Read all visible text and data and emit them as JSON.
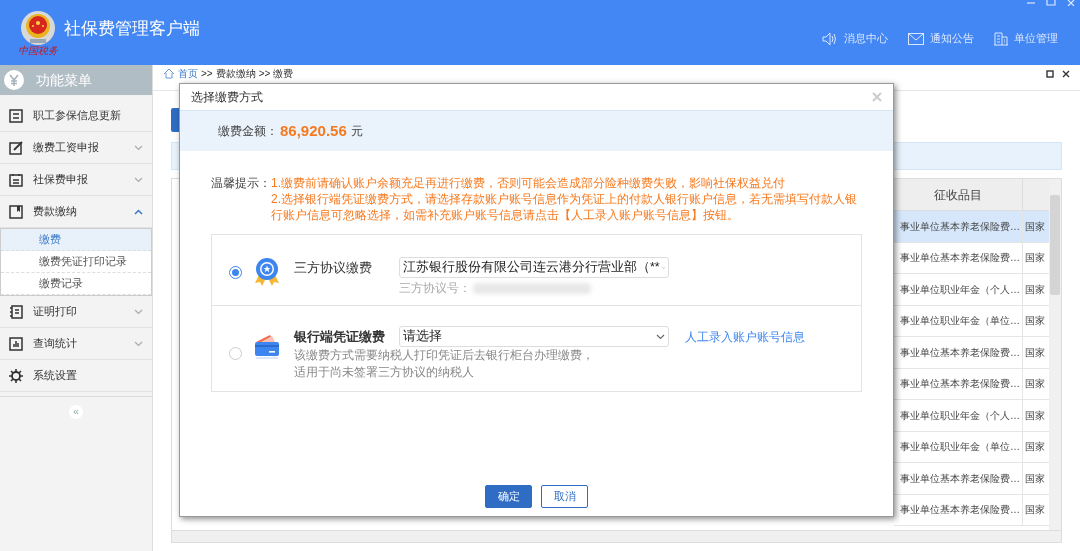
{
  "header": {
    "title": "社保费管理客户端",
    "logo_text": "中国税务",
    "links": [
      {
        "label": "消息中心"
      },
      {
        "label": "通知公告"
      },
      {
        "label": "单位管理"
      }
    ]
  },
  "sidebar": {
    "title": "功能菜单",
    "items": [
      {
        "label": "职工参保信息更新"
      },
      {
        "label": "缴费工资申报",
        "expanded": false
      },
      {
        "label": "社保费申报",
        "expanded": false
      },
      {
        "label": "费款缴纳",
        "expanded": true,
        "children": [
          {
            "label": "缴费",
            "selected": true
          },
          {
            "label": "缴费凭证打印记录",
            "selected": false
          },
          {
            "label": "缴费记录",
            "selected": false
          }
        ]
      },
      {
        "label": "证明打印",
        "expanded": false
      },
      {
        "label": "查询统计",
        "expanded": false
      },
      {
        "label": "系统设置"
      }
    ],
    "collapse": "«"
  },
  "breadcrumb": [
    {
      "label": "首页",
      "kind": "link"
    },
    {
      "label": ">>",
      "kind": "sep"
    },
    {
      "label": "费款缴纳",
      "kind": "text"
    },
    {
      "label": ">>",
      "kind": "sep"
    },
    {
      "label": "缴费",
      "kind": "text"
    }
  ],
  "table": {
    "columns": [
      "征收品目"
    ],
    "rows": [
      {
        "selected": true,
        "cells": [
          "事业单位基本养老保险费…",
          "国家"
        ]
      },
      {
        "selected": false,
        "cells": [
          "事业单位基本养老保险费…",
          "国家"
        ]
      },
      {
        "selected": false,
        "cells": [
          "事业单位职业年金（个人…",
          "国家"
        ]
      },
      {
        "selected": false,
        "cells": [
          "事业单位职业年金（单位…",
          "国家"
        ]
      },
      {
        "selected": false,
        "cells": [
          "事业单位基本养老保险费…",
          "国家"
        ]
      },
      {
        "selected": false,
        "cells": [
          "事业单位基本养老保险费…",
          "国家"
        ]
      },
      {
        "selected": false,
        "cells": [
          "事业单位职业年金（个人…",
          "国家"
        ]
      },
      {
        "selected": false,
        "cells": [
          "事业单位职业年金（单位…",
          "国家"
        ]
      },
      {
        "selected": false,
        "cells": [
          "事业单位基本养老保险费…",
          "国家"
        ]
      },
      {
        "selected": false,
        "cells": [
          "事业单位基本养老保险费…",
          "国家"
        ]
      }
    ]
  },
  "dialog": {
    "title": "选择缴费方式",
    "amount_label": "缴费金额：",
    "amount": "86,920.56",
    "amount_unit": "元",
    "notice_label": "温馨提示：",
    "notices": [
      "1.缴费前请确认账户余额充足再进行缴费，否则可能会造成部分险种缴费失败，影响社保权益兑付",
      "2.选择银行端凭证缴费方式，请选择存款账户账号信息作为凭证上的付款人银行账户信息，若无需填写付款人银行账户信息可忽略选择，如需补充账户账号信息请点击【人工录入账户账号信息】按钮。"
    ],
    "options": [
      {
        "label": "三方协议缴费",
        "selected": true,
        "select_value": "江苏银行股份有限公司连云港分行营业部（**",
        "sub_label": "三方协议号："
      },
      {
        "label": "银行端凭证缴费",
        "selected": false,
        "select_value": "请选择",
        "link": "人工录入账户账号信息",
        "description": [
          "该缴费方式需要纳税人打印凭证后去银行柜台办理缴费，",
          "适用于尚未签署三方协议的纳税人"
        ]
      }
    ],
    "buttons": [
      {
        "label": "确定",
        "kind": "primary"
      },
      {
        "label": "取消",
        "kind": "secondary"
      }
    ]
  }
}
